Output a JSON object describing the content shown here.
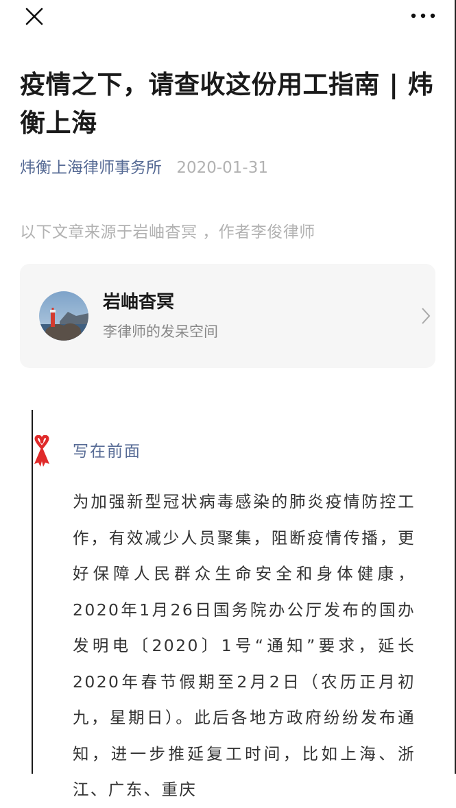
{
  "topbar": {
    "close_icon": "close-icon",
    "more_icon": "more-icon"
  },
  "article": {
    "title": "疫情之下，请查收这份用工指南 | 炜衡上海",
    "author": "炜衡上海律师事务所",
    "date": "2020-01-31",
    "source_note": "以下文章来源于岩岫杳冥 ，作者李俊律师"
  },
  "source_card": {
    "name": "岩岫杳冥",
    "description": "李律师的发呆空间",
    "chevron_icon": "chevron-right-icon"
  },
  "section": {
    "heading": "写在前面",
    "ribbon_icon": "ribbon-icon",
    "body": "为加强新型冠状病毒感染的肺炎疫情防控工作，有效减少人员聚集，阻断疫情传播，更好保障人民群众生命安全和身体健康，2020年1月26日国务院办公厅发布的国办发明电〔2020〕1号“通知”要求，延长2020年春节假期至2月2日（农历正月初九，星期日）。此后各地方政府纷纷发布通知，进一步推延复工时间，比如上海、浙江、广东、重庆"
  },
  "colors": {
    "link": "#576b95",
    "meta_gray": "#b2b2b2",
    "card_bg": "#f6f6f6",
    "ribbon_red": "#e02a2a"
  }
}
